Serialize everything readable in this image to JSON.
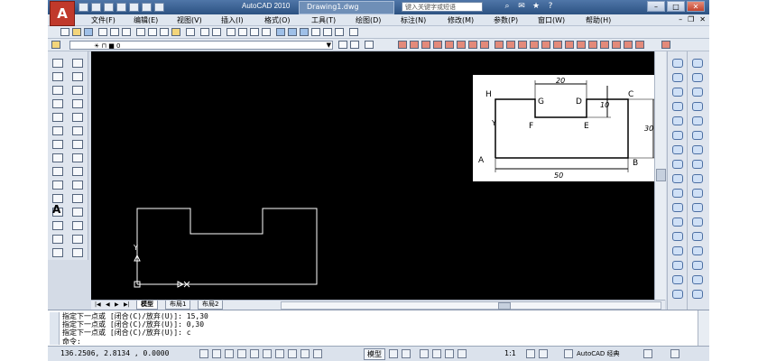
{
  "app": {
    "logo_letter": "A",
    "title": "AutoCAD 2010",
    "document": "Drawing1.dwg",
    "search_placeholder": "键入关键字或短语"
  },
  "menu": [
    "文件(F)",
    "编辑(E)",
    "视图(V)",
    "插入(I)",
    "格式(O)",
    "工具(T)",
    "绘图(D)",
    "标注(N)",
    "修改(M)",
    "参数(P)",
    "窗口(W)",
    "帮助(H)"
  ],
  "tabs": {
    "model": "模型",
    "layout1": "布局1",
    "layout2": "布局2"
  },
  "command_history": [
    "指定下一点或 [闭合(C)/放弃(U)]: 15,30",
    "指定下一点或 [闭合(C)/放弃(U)]: 0,30",
    "指定下一点或 [闭合(C)/放弃(U)]: c"
  ],
  "command_prompt": "命令:",
  "status": {
    "coordinates": "136.2506, 2.8134 , 0.0000",
    "model_button": "模型",
    "annotation_scale": "1:1",
    "workspace": "AutoCAD 经典"
  },
  "reference_figure": {
    "points": [
      "H",
      "G",
      "D",
      "C",
      "F",
      "E",
      "A",
      "B"
    ],
    "dimensions": [
      "20",
      "10",
      "30",
      "50"
    ],
    "ucs_y": "Y"
  },
  "drawing": {
    "ucs_y": "Y"
  }
}
